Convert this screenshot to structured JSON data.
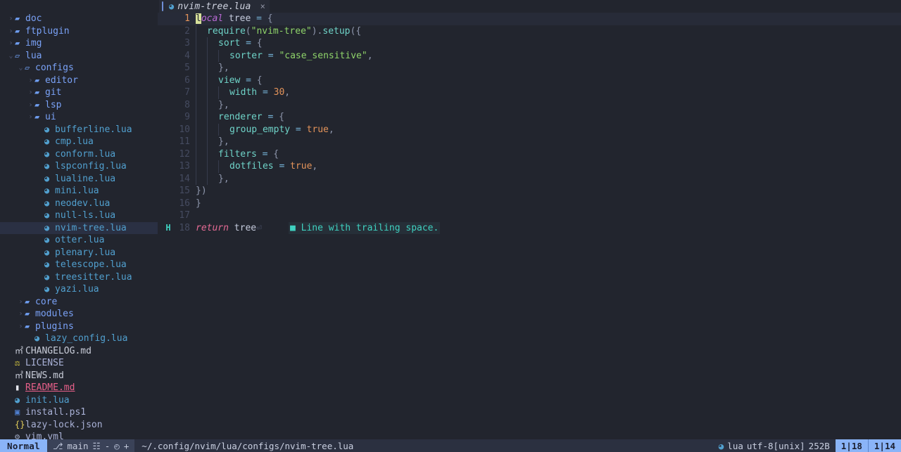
{
  "app": {
    "name": "neovim",
    "theme_bg": "#22252e",
    "accent": "#8ab4f8"
  },
  "tabline": {
    "tabs": [
      {
        "icon": "lua-icon",
        "icon_glyph": "◕",
        "label": "nvim-tree.lua",
        "close": "×",
        "active": true
      }
    ]
  },
  "sidebar": {
    "title": "file-explorer",
    "items": [
      {
        "indent": 0,
        "chev": "›",
        "icon": "folder-closed-icon",
        "glyph": "▰",
        "label": "doc",
        "kind": "dir"
      },
      {
        "indent": 0,
        "chev": "›",
        "icon": "folder-closed-icon",
        "glyph": "▰",
        "label": "ftplugin",
        "kind": "dir"
      },
      {
        "indent": 0,
        "chev": "›",
        "icon": "folder-closed-icon",
        "glyph": "▰",
        "label": "img",
        "kind": "dir"
      },
      {
        "indent": 0,
        "chev": "⌄",
        "icon": "folder-open-icon",
        "glyph": "▱",
        "label": "lua",
        "kind": "dir"
      },
      {
        "indent": 1,
        "chev": "⌄",
        "icon": "folder-open-icon",
        "glyph": "▱",
        "label": "configs",
        "kind": "dir"
      },
      {
        "indent": 2,
        "chev": "›",
        "icon": "folder-closed-icon",
        "glyph": "▰",
        "label": "editor",
        "kind": "dir"
      },
      {
        "indent": 2,
        "chev": "›",
        "icon": "folder-closed-icon",
        "glyph": "▰",
        "label": "git",
        "kind": "dir"
      },
      {
        "indent": 2,
        "chev": "›",
        "icon": "folder-closed-icon",
        "glyph": "▰",
        "label": "lsp",
        "kind": "dir"
      },
      {
        "indent": 2,
        "chev": "›",
        "icon": "folder-closed-icon",
        "glyph": "▰",
        "label": "ui",
        "kind": "dir"
      },
      {
        "indent": 3,
        "chev": "",
        "icon": "lua-icon",
        "glyph": "◕",
        "label": "bufferline.lua",
        "kind": "lua"
      },
      {
        "indent": 3,
        "chev": "",
        "icon": "lua-icon",
        "glyph": "◕",
        "label": "cmp.lua",
        "kind": "lua"
      },
      {
        "indent": 3,
        "chev": "",
        "icon": "lua-icon",
        "glyph": "◕",
        "label": "conform.lua",
        "kind": "lua"
      },
      {
        "indent": 3,
        "chev": "",
        "icon": "lua-icon",
        "glyph": "◕",
        "label": "lspconfig.lua",
        "kind": "lua"
      },
      {
        "indent": 3,
        "chev": "",
        "icon": "lua-icon",
        "glyph": "◕",
        "label": "lualine.lua",
        "kind": "lua"
      },
      {
        "indent": 3,
        "chev": "",
        "icon": "lua-icon",
        "glyph": "◕",
        "label": "mini.lua",
        "kind": "lua"
      },
      {
        "indent": 3,
        "chev": "",
        "icon": "lua-icon",
        "glyph": "◕",
        "label": "neodev.lua",
        "kind": "lua"
      },
      {
        "indent": 3,
        "chev": "",
        "icon": "lua-icon",
        "glyph": "◕",
        "label": "null-ls.lua",
        "kind": "lua"
      },
      {
        "indent": 3,
        "chev": "",
        "icon": "lua-icon",
        "glyph": "◕",
        "label": "nvim-tree.lua",
        "kind": "lua",
        "selected": true
      },
      {
        "indent": 3,
        "chev": "",
        "icon": "lua-icon",
        "glyph": "◕",
        "label": "otter.lua",
        "kind": "lua"
      },
      {
        "indent": 3,
        "chev": "",
        "icon": "lua-icon",
        "glyph": "◕",
        "label": "plenary.lua",
        "kind": "lua"
      },
      {
        "indent": 3,
        "chev": "",
        "icon": "lua-icon",
        "glyph": "◕",
        "label": "telescope.lua",
        "kind": "lua"
      },
      {
        "indent": 3,
        "chev": "",
        "icon": "lua-icon",
        "glyph": "◕",
        "label": "treesitter.lua",
        "kind": "lua"
      },
      {
        "indent": 3,
        "chev": "",
        "icon": "lua-icon",
        "glyph": "◕",
        "label": "yazi.lua",
        "kind": "lua"
      },
      {
        "indent": 1,
        "chev": "›",
        "icon": "folder-closed-icon",
        "glyph": "▰",
        "label": "core",
        "kind": "dir"
      },
      {
        "indent": 1,
        "chev": "›",
        "icon": "folder-closed-icon",
        "glyph": "▰",
        "label": "modules",
        "kind": "dir"
      },
      {
        "indent": 1,
        "chev": "›",
        "icon": "folder-closed-icon",
        "glyph": "▰",
        "label": "plugins",
        "kind": "dir"
      },
      {
        "indent": 2,
        "chev": "",
        "icon": "lua-icon",
        "glyph": "◕",
        "label": "lazy_config.lua",
        "kind": "lua"
      },
      {
        "indent": 0,
        "chev": "",
        "icon": "markdown-icon",
        "glyph": "㎡",
        "label": "CHANGELOG.md",
        "kind": "md"
      },
      {
        "indent": 0,
        "chev": "",
        "icon": "license-icon",
        "glyph": "⚖",
        "label": "LICENSE",
        "kind": "license"
      },
      {
        "indent": 0,
        "chev": "",
        "icon": "markdown-icon",
        "glyph": "㎡",
        "label": "NEWS.md",
        "kind": "md"
      },
      {
        "indent": 0,
        "chev": "",
        "icon": "book-icon",
        "glyph": "▮",
        "label": "README.md",
        "kind": "readme"
      },
      {
        "indent": 0,
        "chev": "",
        "icon": "lua-icon",
        "glyph": "◕",
        "label": "init.lua",
        "kind": "lua"
      },
      {
        "indent": 0,
        "chev": "",
        "icon": "powershell-icon",
        "glyph": "▣",
        "label": "install.ps1",
        "kind": "ps1"
      },
      {
        "indent": 0,
        "chev": "",
        "icon": "json-icon",
        "glyph": "{}",
        "label": "lazy-lock.json",
        "kind": "json"
      },
      {
        "indent": 0,
        "chev": "",
        "icon": "gear-icon",
        "glyph": "⚙",
        "label": "vim.yml",
        "kind": "yml"
      }
    ]
  },
  "editor": {
    "filename": "nvim-tree.lua",
    "cursor_line": 1,
    "cursor_col": 1,
    "lines": [
      {
        "n": 1,
        "sign": "",
        "indent": 0
      },
      {
        "n": 2,
        "sign": "",
        "indent": 1
      },
      {
        "n": 3,
        "sign": "",
        "indent": 2
      },
      {
        "n": 4,
        "sign": "",
        "indent": 3
      },
      {
        "n": 5,
        "sign": "",
        "indent": 2
      },
      {
        "n": 6,
        "sign": "",
        "indent": 2
      },
      {
        "n": 7,
        "sign": "",
        "indent": 3
      },
      {
        "n": 8,
        "sign": "",
        "indent": 2
      },
      {
        "n": 9,
        "sign": "",
        "indent": 2
      },
      {
        "n": 10,
        "sign": "",
        "indent": 3
      },
      {
        "n": 11,
        "sign": "",
        "indent": 2
      },
      {
        "n": 12,
        "sign": "",
        "indent": 2
      },
      {
        "n": 13,
        "sign": "",
        "indent": 3
      },
      {
        "n": 14,
        "sign": "",
        "indent": 2
      },
      {
        "n": 15,
        "sign": "",
        "indent": 0
      },
      {
        "n": 16,
        "sign": "",
        "indent": 0
      },
      {
        "n": 17,
        "sign": "",
        "indent": 0
      },
      {
        "n": 18,
        "sign": "H",
        "indent": 0
      }
    ],
    "source_text": [
      "local tree = {",
      "  require(\"nvim-tree\").setup({",
      "    sort = {",
      "      sorter = \"case_sensitive\",",
      "    },",
      "    view = {",
      "      width = 30,",
      "    },",
      "    renderer = {",
      "      group_empty = true,",
      "    },",
      "    filters = {",
      "      dotfiles = true,",
      "    },",
      "})",
      "}",
      "",
      "return tree "
    ],
    "diagnostic": {
      "line": 18,
      "marker": "■",
      "message": "Line with trailing space.",
      "sign": "H",
      "color": "#3fd1c0"
    }
  },
  "statusline": {
    "mode": "Normal",
    "git_branch_icon": "⎇",
    "git_branch": "main",
    "git_added_icon": "☷",
    "git_added": "-",
    "git_changed_icon": "◴",
    "git_changed": "+",
    "path": "~/.config/nvim/lua/configs/nvim-tree.lua",
    "filetype_icon": "◕",
    "filetype": "lua",
    "encoding": "utf-8[unix]",
    "filesize": "252B",
    "position_line": "1|18",
    "position_col": "1|14"
  }
}
